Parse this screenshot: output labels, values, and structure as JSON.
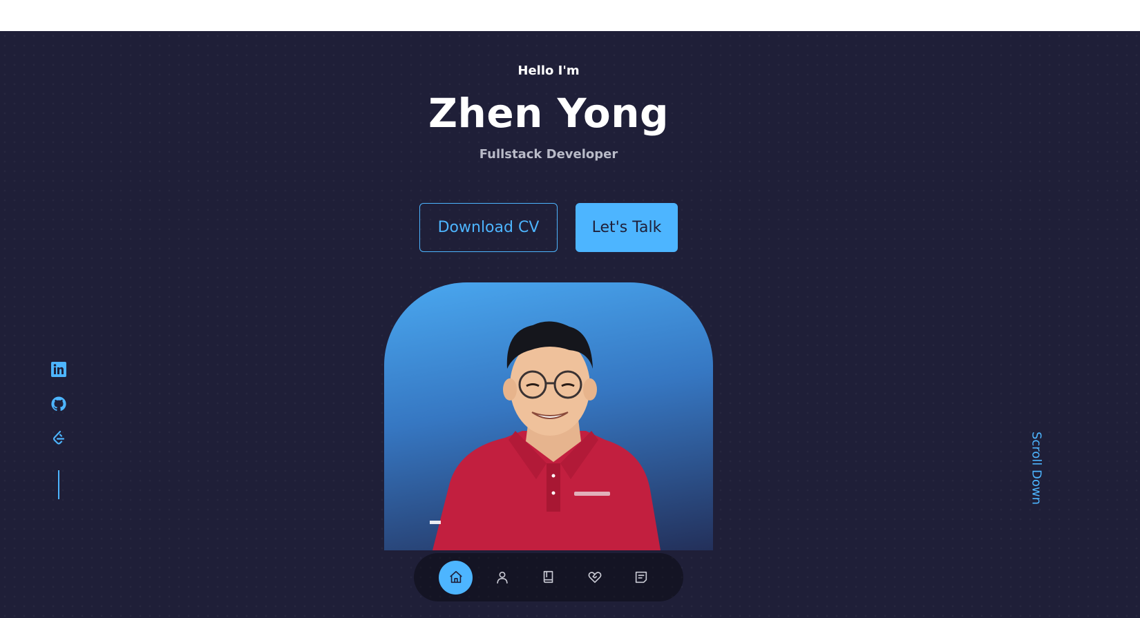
{
  "header": {
    "greeting": "Hello I'm",
    "name": "Zhen Yong",
    "role": "Fullstack Developer"
  },
  "cta": {
    "download_label": "Download CV",
    "talk_label": "Let's Talk"
  },
  "socials": [
    {
      "icon": "linkedin-icon"
    },
    {
      "icon": "github-icon"
    },
    {
      "icon": "leetcode-icon"
    }
  ],
  "scroll": {
    "label": "Scroll Down"
  },
  "nav": {
    "items": [
      {
        "icon": "home-icon",
        "active": true
      },
      {
        "icon": "user-icon",
        "active": false
      },
      {
        "icon": "book-icon",
        "active": false
      },
      {
        "icon": "heart-handshake-icon",
        "active": false
      },
      {
        "icon": "message-icon",
        "active": false
      }
    ]
  },
  "colors": {
    "background": "#1f1f38",
    "accent": "#4db5ff",
    "text": "#ffffff",
    "muted": "#b9bbc8",
    "shirt": "#c21f3f"
  }
}
